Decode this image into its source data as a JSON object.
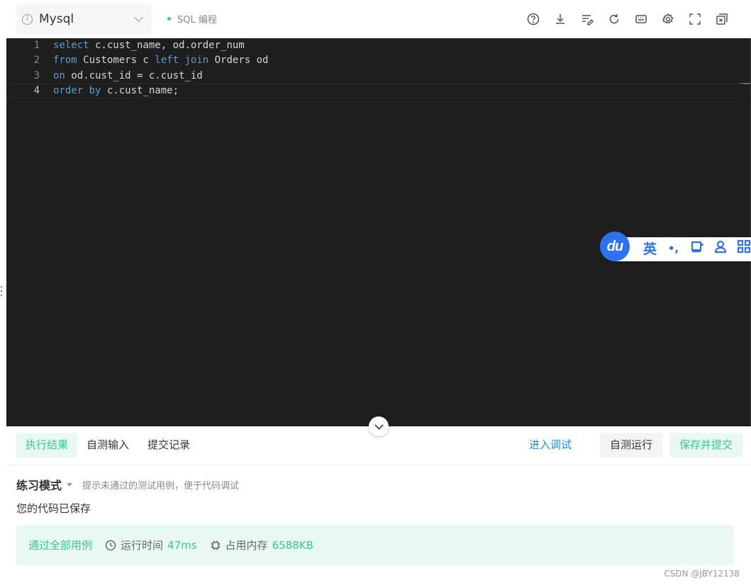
{
  "header": {
    "language_select": "Mysql",
    "mode_tag": "SQL 编程"
  },
  "editor": {
    "lines": [
      {
        "n": "1",
        "tokens": [
          {
            "t": "select",
            "kw": true
          },
          {
            "t": " c.cust_name, od.order_num",
            "kw": false
          }
        ]
      },
      {
        "n": "2",
        "tokens": [
          {
            "t": "from",
            "kw": true
          },
          {
            "t": " Customers c ",
            "kw": false
          },
          {
            "t": "left",
            "kw": true
          },
          {
            "t": " ",
            "kw": false
          },
          {
            "t": "join",
            "kw": true
          },
          {
            "t": " Orders od",
            "kw": false
          }
        ]
      },
      {
        "n": "3",
        "tokens": [
          {
            "t": "on",
            "kw": true
          },
          {
            "t": " od.cust_id = c.cust_id",
            "kw": false
          }
        ]
      },
      {
        "n": "4",
        "tokens": [
          {
            "t": "order",
            "kw": true
          },
          {
            "t": " ",
            "kw": false
          },
          {
            "t": "by",
            "kw": true
          },
          {
            "t": " c.cust_name;",
            "kw": false
          }
        ]
      }
    ],
    "active_line": "4"
  },
  "ime": {
    "logo": "du",
    "lang": "英",
    "punct": "•,"
  },
  "result": {
    "tabs": [
      "执行结果",
      "自测输入",
      "提交记录"
    ],
    "active_tab": 0,
    "debug_link": "进入调试",
    "self_test_button": "自测运行",
    "submit_button": "保存并提交",
    "mode_title": "练习模式",
    "mode_hint": "提示未通过的测试用例，便于代码调试",
    "saved_msg": "您的代码已保存",
    "pass_text": "通过全部用例",
    "runtime_label": "运行时间",
    "runtime_value": "47ms",
    "memory_label": "占用内存",
    "memory_value": "6588KB"
  },
  "watermark": "CSDN @JBY12138",
  "colors": {
    "accent": "#32ca99",
    "link": "#1890ff",
    "editor_bg": "#1e1e1e",
    "keyword": "#569cd6",
    "ime_blue": "#2e72f0"
  }
}
